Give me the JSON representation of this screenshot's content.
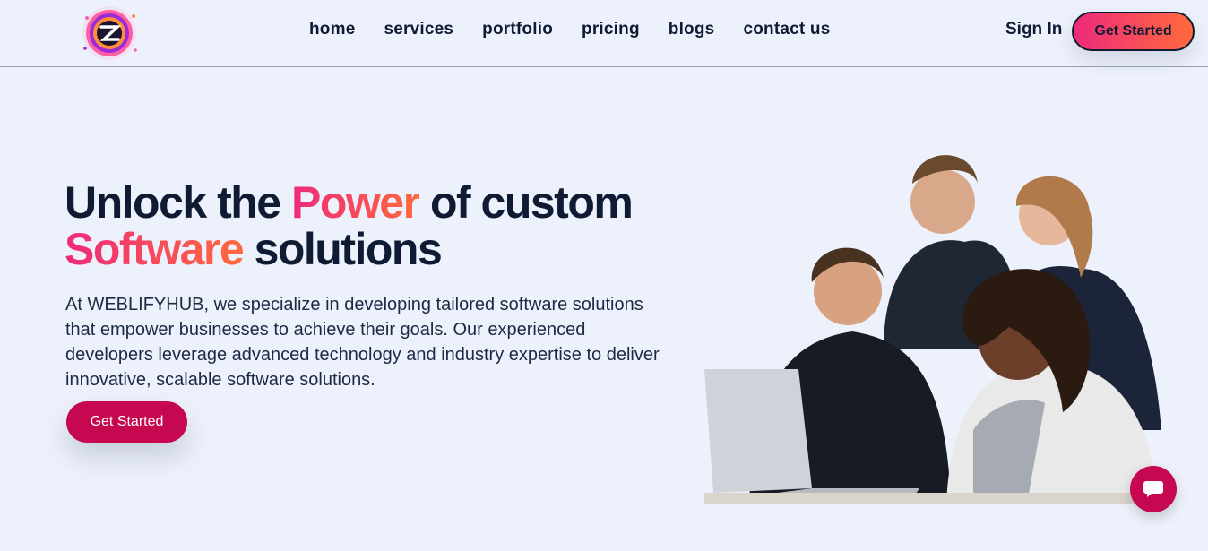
{
  "header": {
    "nav": [
      "home",
      "services",
      "portfolio",
      "pricing",
      "blogs",
      "contact us"
    ],
    "sign_in": "Sign In",
    "cta": "Get Started"
  },
  "hero": {
    "title_1": "Unlock the ",
    "title_power": "Power",
    "title_2": " of custom",
    "title_software": "Software",
    "title_3": " solutions",
    "description": "At WEBLIFYHUB, we specialize in developing tailored software solutions that empower businesses to achieve their goals. Our experienced developers leverage advanced technology and industry expertise to deliver innovative, scalable software solutions.",
    "cta": "Get Started"
  },
  "colors": {
    "accent_gradient_start": "#ee2a7b",
    "accent_gradient_end": "#ff6a3d",
    "button_primary": "#c5084f",
    "text_dark": "#0f1b33",
    "background": "#ecf1fb"
  },
  "icons": {
    "logo": "brand-logo-icon",
    "chat": "chat-bubble-icon"
  }
}
